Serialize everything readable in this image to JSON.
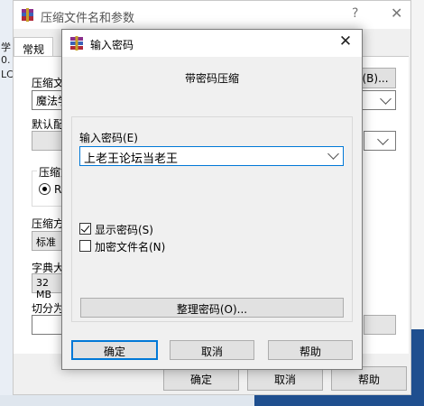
{
  "desktop": {
    "left_fragments": [
      "学",
      "0.",
      "LC"
    ]
  },
  "background_window": {
    "title": "压缩文件名和参数",
    "help_glyph": "?",
    "close_glyph": "✕",
    "tab_general": "常规",
    "archive_name_label": "压缩文",
    "archive_name_value": "魔法学",
    "browse_button": "(B)...",
    "default_profile_label": "默认配",
    "archive_format_label": "压缩文",
    "format_option": "RA",
    "compression_method_label": "压缩方",
    "compression_method_value": "标准",
    "dictionary_size_label": "字典大",
    "dictionary_size_value": "32 MB",
    "split_label": "切分为",
    "ok_button": "确定",
    "cancel_button": "取消",
    "help_button": "帮助"
  },
  "dialog": {
    "title": "输入密码",
    "close_glyph": "✕",
    "heading": "带密码压缩",
    "password_label": "输入密码(E)",
    "password_value": "上老王论坛当老王",
    "show_password_label": "显示密码(S)",
    "show_password_checked": true,
    "encrypt_filenames_label": "加密文件名(N)",
    "encrypt_filenames_checked": false,
    "organize_button": "整理密码(O)...",
    "ok_button": "确定",
    "cancel_button": "取消",
    "help_button": "帮助"
  },
  "colors": {
    "accent": "#0078d7",
    "button_face": "#e1e1e1",
    "window_bg": "#f0f0f0"
  }
}
